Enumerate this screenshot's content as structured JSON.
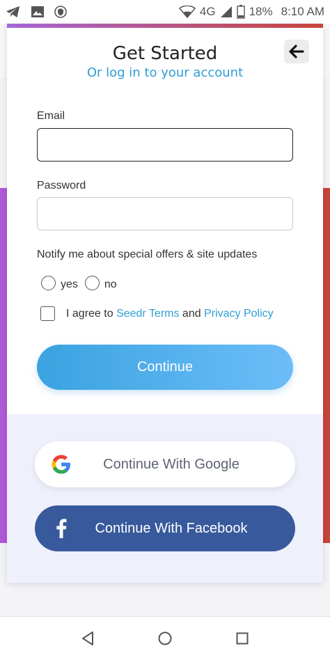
{
  "status_bar": {
    "battery": "18%",
    "time": "8:10 AM",
    "network": "4G",
    "icons": [
      "telegram-icon",
      "image-icon",
      "vpn-shield-icon",
      "wifi-icon",
      "signal-icon",
      "battery-icon"
    ]
  },
  "modal": {
    "title": "Get Started",
    "subtitle": "Or log in to your account",
    "back_icon": "arrow-left-icon",
    "email_label": "Email",
    "email_value": "",
    "password_label": "Password",
    "password_value": "",
    "notify_text": "Notify me about special offers & site updates",
    "radio_options": [
      "yes",
      "no"
    ],
    "agree_prefix": "I agree to",
    "terms_link": "Seedr Terms",
    "agree_and": "and",
    "privacy_link": "Privacy Policy",
    "continue_label": "Continue"
  },
  "social": {
    "google_label": "Continue With Google",
    "facebook_label": "Continue With Facebook"
  },
  "colors": {
    "accent_blue": "#2f9ed6",
    "facebook_blue": "#385a9c",
    "social_panel": "#eef0fc"
  },
  "nav_bar": {
    "icons": [
      "back-triangle-icon",
      "home-circle-icon",
      "recents-square-icon"
    ]
  }
}
